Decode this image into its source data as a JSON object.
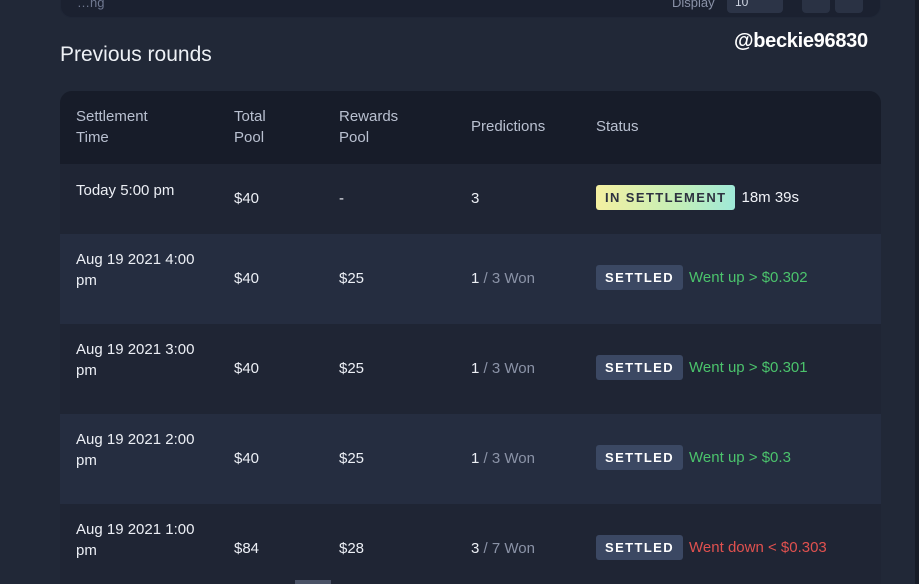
{
  "top_card": {
    "left_text": "…ng",
    "display_label": "Display",
    "display_value": "10"
  },
  "section_title": "Previous rounds",
  "watermark": "@beckie96830",
  "table": {
    "headers": {
      "settlement_time": "Settlement Time",
      "total_pool": "Total Pool",
      "rewards_pool": "Rewards Pool",
      "predictions": "Predictions",
      "status": "Status"
    },
    "rows": [
      {
        "time": "Today 5:00 pm",
        "total": "$40",
        "rewards": "-",
        "pred_main": "3",
        "pred_rest": "",
        "badge": "IN SETTLEMENT",
        "status_text": "18m 39s"
      },
      {
        "time": "Aug 19 2021 4:00 pm",
        "total": "$40",
        "rewards": "$25",
        "pred_main": "1",
        "pred_rest": " / 3 Won",
        "badge": "SETTLED",
        "status_text": "Went up > $0.302"
      },
      {
        "time": "Aug 19 2021 3:00 pm",
        "total": "$40",
        "rewards": "$25",
        "pred_main": "1",
        "pred_rest": " / 3 Won",
        "badge": "SETTLED",
        "status_text": "Went up > $0.301"
      },
      {
        "time": "Aug 19 2021 2:00 pm",
        "total": "$40",
        "rewards": "$25",
        "pred_main": "1",
        "pred_rest": " / 3 Won",
        "badge": "SETTLED",
        "status_text": "Went up > $0.3"
      },
      {
        "time": "Aug 19 2021 1:00 pm",
        "total": "$84",
        "rewards": "$28",
        "pred_main": "3",
        "pred_rest": " / 7 Won",
        "badge": "SETTLED",
        "status_text": "Went down < $0.303"
      }
    ]
  },
  "colors": {
    "up": "#4bc36c",
    "down": "#e0514f",
    "settled_badge": "#3b4863"
  }
}
